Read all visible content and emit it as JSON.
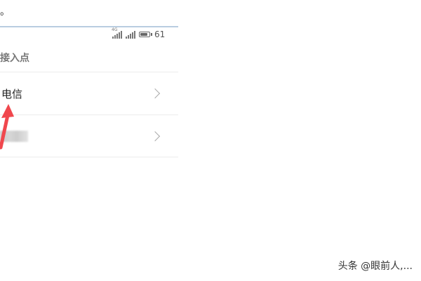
{
  "top_text": "。",
  "status_bar": {
    "signal_tag": "4G",
    "battery_level": 0.85,
    "battery_text": "61"
  },
  "section_header": "接入点",
  "apn_list": [
    {
      "label": "电信",
      "blurred": false
    },
    {
      "label": "",
      "blurred": true
    }
  ],
  "annotation_color": "#f0474d",
  "watermark": "头条 @眼前人,..."
}
